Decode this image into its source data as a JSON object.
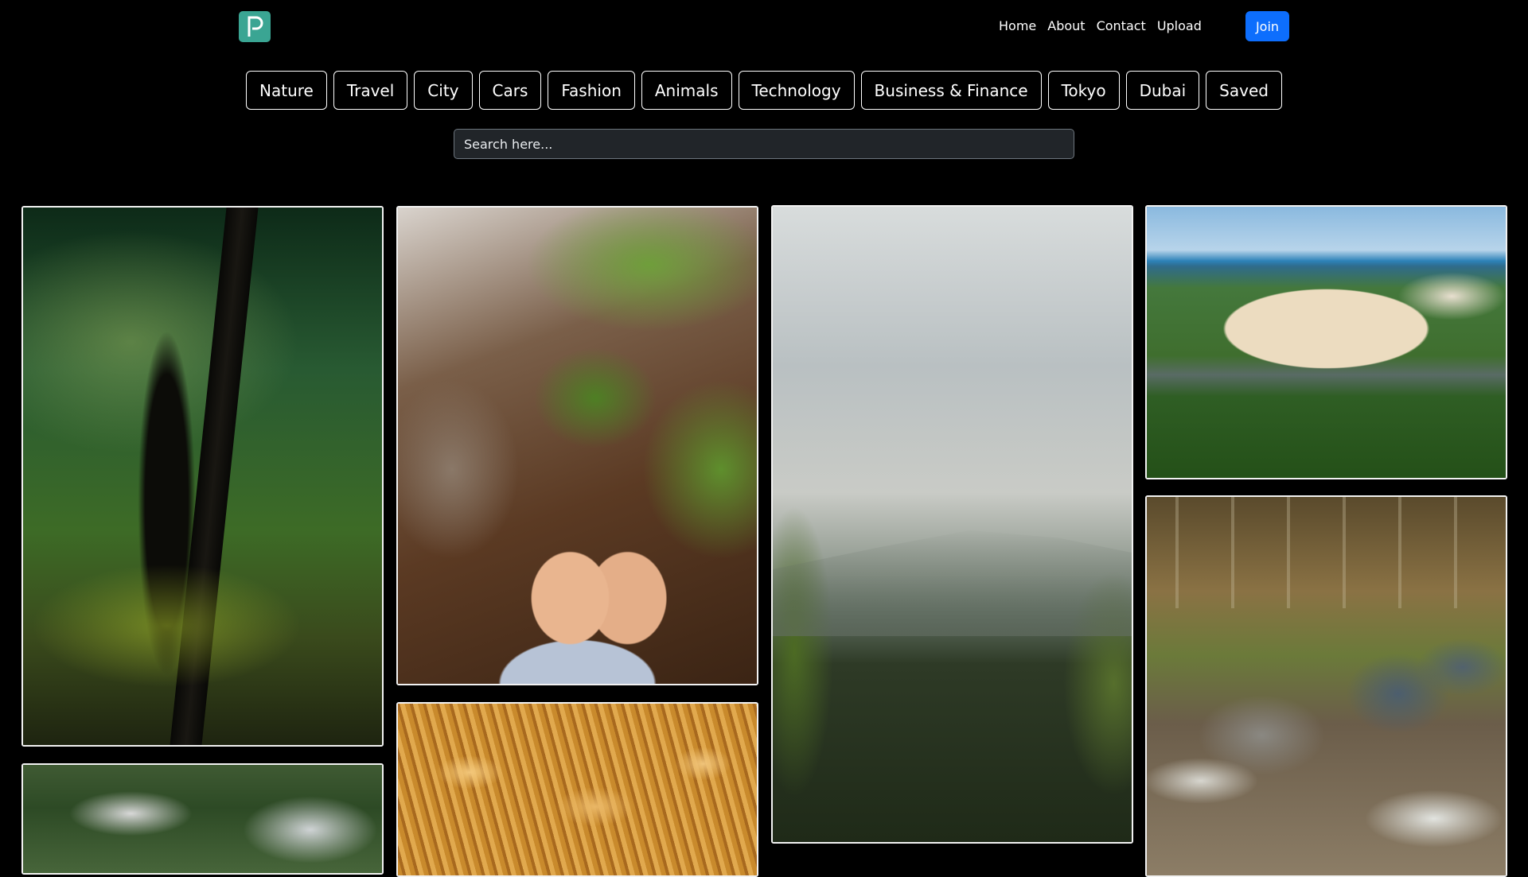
{
  "brand": {
    "logo_letter": "P"
  },
  "nav": {
    "links": [
      "Home",
      "About",
      "Contact",
      "Upload"
    ],
    "join_label": "Join"
  },
  "categories": [
    "Nature",
    "Travel",
    "City",
    "Cars",
    "Fashion",
    "Animals",
    "Technology",
    "Business & Finance",
    "Tokyo",
    "Dubai",
    "Saved"
  ],
  "search": {
    "placeholder": "Search here...",
    "value": ""
  },
  "gallery": {
    "photos": [
      {
        "subject": "misty forest tree"
      },
      {
        "subject": "bare feet in stream on mossy rocks"
      },
      {
        "subject": "mountain view through branches"
      },
      {
        "subject": "aerial coastal sand dunes"
      },
      {
        "subject": "tree canopy"
      },
      {
        "subject": "golden wheat field"
      },
      {
        "subject": "rocky river rapids"
      }
    ]
  }
}
